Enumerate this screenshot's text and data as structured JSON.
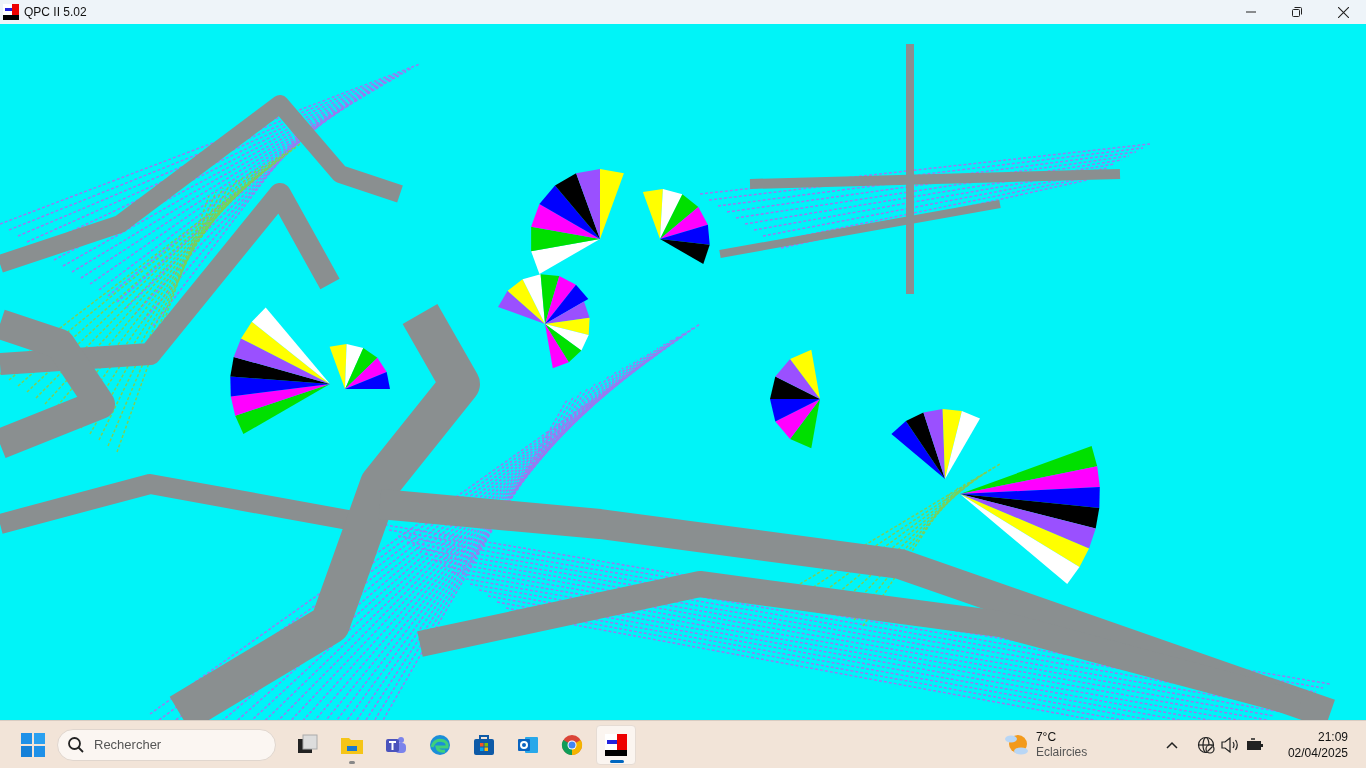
{
  "window": {
    "title": "QPC II 5.02"
  },
  "taskbar": {
    "search": {
      "placeholder": "Rechercher"
    },
    "apps": [
      {
        "kind": "task-view",
        "selected": false,
        "running": false
      },
      {
        "kind": "file-explorer",
        "selected": false,
        "running": true
      },
      {
        "kind": "teams",
        "selected": false,
        "running": false
      },
      {
        "kind": "edge",
        "selected": false,
        "running": false
      },
      {
        "kind": "store",
        "selected": false,
        "running": false
      },
      {
        "kind": "outlook",
        "selected": false,
        "running": false
      },
      {
        "kind": "chrome",
        "selected": false,
        "running": false
      },
      {
        "kind": "qpc",
        "selected": true,
        "running": true
      }
    ],
    "weather": {
      "temperature": "7°C",
      "condition": "Eclaircies"
    },
    "clock": {
      "time": "21:09",
      "date": "02/04/2025"
    }
  }
}
